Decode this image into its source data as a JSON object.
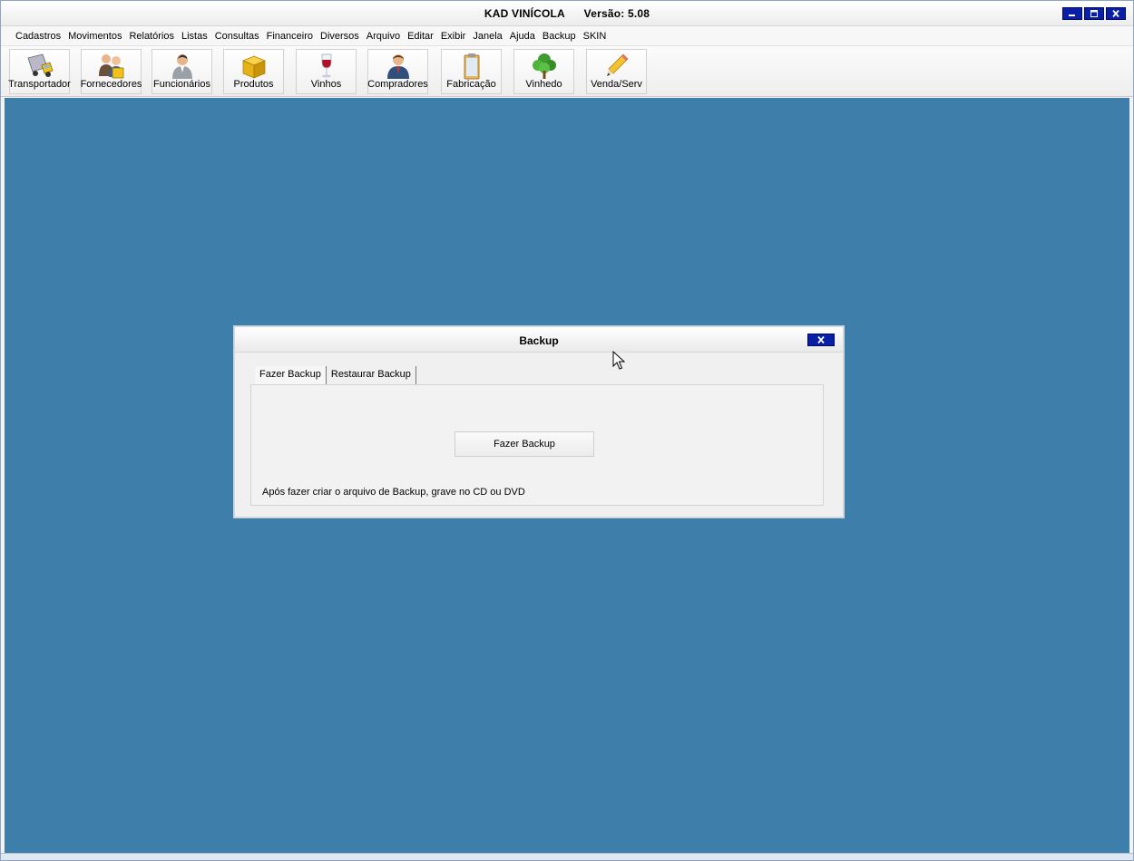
{
  "window": {
    "title": "KAD VINÍCOLA      Versão: 5.08",
    "controls": [
      "minimize-icon",
      "maximize-icon",
      "close-icon"
    ]
  },
  "menu": [
    "Cadastros",
    "Movimentos",
    "Relatórios",
    "Listas",
    "Consultas",
    "Financeiro",
    "Diversos",
    "Arquivo",
    "Editar",
    "Exibir",
    "Janela",
    "Ajuda",
    "Backup",
    "SKIN"
  ],
  "toolbar": [
    {
      "label": "Transportador",
      "icon": "truck-icon"
    },
    {
      "label": "Fornecedores",
      "icon": "suppliers-icon"
    },
    {
      "label": "Funcionários",
      "icon": "employee-icon"
    },
    {
      "label": "Produtos",
      "icon": "box-icon"
    },
    {
      "label": "Vinhos",
      "icon": "wine-glass-icon"
    },
    {
      "label": "Compradores",
      "icon": "buyer-icon"
    },
    {
      "label": "Fabricação",
      "icon": "clipboard-icon"
    },
    {
      "label": "Vinhedo",
      "icon": "tree-icon"
    },
    {
      "label": "Venda/Serv",
      "icon": "pencil-icon"
    }
  ],
  "dialog": {
    "title": "Backup",
    "tabs": [
      "Fazer Backup",
      "Restaurar Backup"
    ],
    "active_tab": "Fazer Backup",
    "button_label": "Fazer Backup",
    "hint": "Após fazer criar o arquivo de Backup, grave no CD ou DVD"
  },
  "colors": {
    "workspace": "#3d7faa",
    "control_blue": "#0a1fa8"
  }
}
